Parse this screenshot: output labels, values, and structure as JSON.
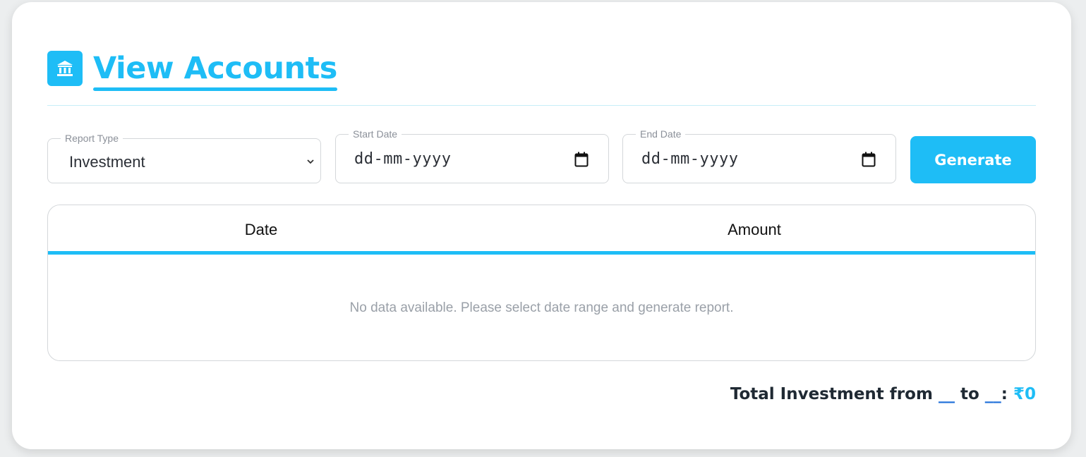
{
  "header": {
    "icon": "bank-icon",
    "title": "View Accounts"
  },
  "filters": {
    "report_type": {
      "label": "Report Type",
      "value": "Investment"
    },
    "start_date": {
      "label": "Start Date",
      "placeholder": "dd-mm-yyyy"
    },
    "end_date": {
      "label": "End Date",
      "placeholder": "dd-mm-yyyy"
    },
    "generate_label": "Generate"
  },
  "table": {
    "columns": [
      "Date",
      "Amount"
    ],
    "empty_message": "No data available. Please select date range and generate report."
  },
  "total": {
    "prefix": "Total Investment from",
    "from_blank": "__",
    "connector": "to",
    "to_blank": "__",
    "colon": ":",
    "amount": "₹0"
  },
  "colors": {
    "accent": "#1ebdf6",
    "text_dark": "#1f2933",
    "muted": "#9aa0a8"
  }
}
